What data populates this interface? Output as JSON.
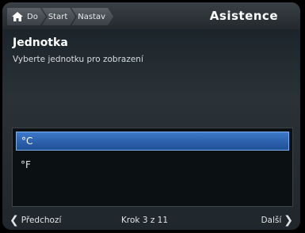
{
  "header": {
    "breadcrumbs": [
      "Do",
      "Start",
      "Nastav"
    ],
    "title": "Asistence"
  },
  "section": {
    "title": "Jednotka",
    "instruction": "Vyberte jednotku pro zobrazení"
  },
  "units": {
    "options": [
      "°C",
      "°F"
    ],
    "selected": "°C"
  },
  "footer": {
    "back_label": "Předchozí",
    "step_label": "Krok 3 z 11",
    "next_label": "Další"
  },
  "colors": {
    "selection": "#2f66b5",
    "background": "#1f272c"
  }
}
